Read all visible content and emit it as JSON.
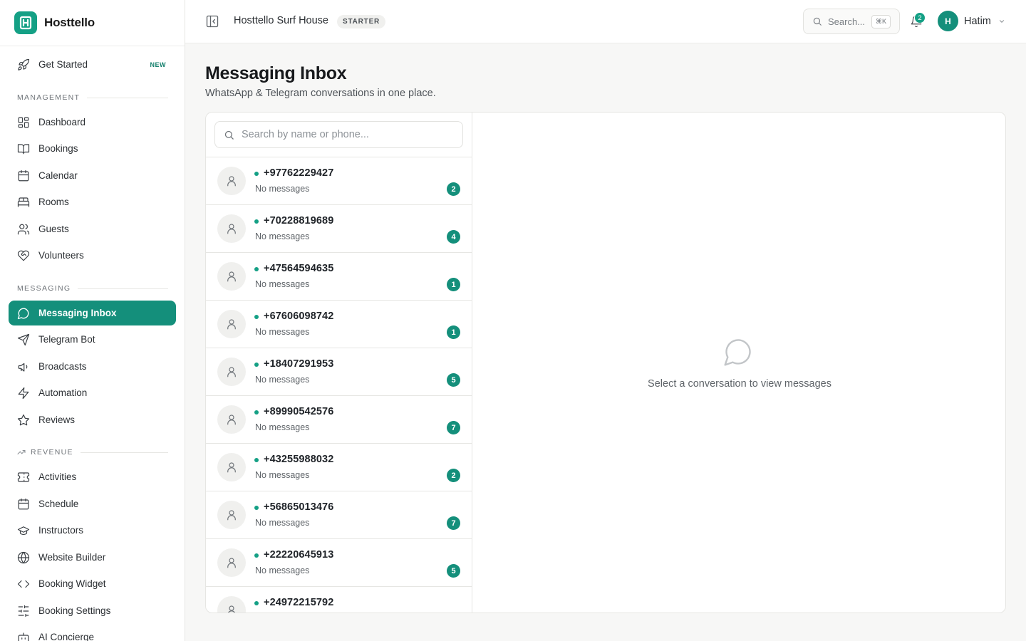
{
  "brand": {
    "name": "Hosttello"
  },
  "sidebar": {
    "get_started": {
      "label": "Get Started",
      "badge": "NEW",
      "icon": "rocket-icon"
    },
    "sections": {
      "management": "MANAGEMENT",
      "messaging": "MESSAGING",
      "revenue": "REVENUE"
    },
    "management_items": [
      {
        "label": "Dashboard",
        "icon": "dashboard-icon"
      },
      {
        "label": "Bookings",
        "icon": "book-icon"
      },
      {
        "label": "Calendar",
        "icon": "calendar-icon"
      },
      {
        "label": "Rooms",
        "icon": "bed-icon"
      },
      {
        "label": "Guests",
        "icon": "users-icon"
      },
      {
        "label": "Volunteers",
        "icon": "heart-handshake-icon"
      }
    ],
    "messaging_items": [
      {
        "label": "Messaging Inbox",
        "icon": "chat-bubble-icon",
        "active": true
      },
      {
        "label": "Telegram Bot",
        "icon": "send-icon"
      },
      {
        "label": "Broadcasts",
        "icon": "megaphone-icon"
      },
      {
        "label": "Automation",
        "icon": "zap-icon"
      },
      {
        "label": "Reviews",
        "icon": "star-icon"
      }
    ],
    "revenue_items": [
      {
        "label": "Activities",
        "icon": "ticket-icon"
      },
      {
        "label": "Schedule",
        "icon": "calendar-icon"
      },
      {
        "label": "Instructors",
        "icon": "graduation-cap-icon"
      },
      {
        "label": "Website Builder",
        "icon": "globe-icon"
      },
      {
        "label": "Booking Widget",
        "icon": "code-icon"
      },
      {
        "label": "Booking Settings",
        "icon": "sliders-icon"
      },
      {
        "label": "AI Concierge",
        "icon": "bot-icon"
      }
    ]
  },
  "header": {
    "org_name": "Hosttello Surf House",
    "plan": "STARTER",
    "search_placeholder": "Search...",
    "search_shortcut": "⌘K",
    "notifications_count": "2",
    "user": {
      "initial": "H",
      "name": "Hatim"
    }
  },
  "main": {
    "title": "Messaging Inbox",
    "subtitle": "WhatsApp & Telegram conversations in one place.",
    "search_placeholder": "Search by name or phone...",
    "empty_text": "Select a conversation to view messages",
    "conversations": [
      {
        "phone": "+97762229427",
        "preview": "No messages",
        "unread": "2"
      },
      {
        "phone": "+70228819689",
        "preview": "No messages",
        "unread": "4"
      },
      {
        "phone": "+47564594635",
        "preview": "No messages",
        "unread": "1"
      },
      {
        "phone": "+67606098742",
        "preview": "No messages",
        "unread": "1"
      },
      {
        "phone": "+18407291953",
        "preview": "No messages",
        "unread": "5"
      },
      {
        "phone": "+89990542576",
        "preview": "No messages",
        "unread": "7"
      },
      {
        "phone": "+43255988032",
        "preview": "No messages",
        "unread": "2"
      },
      {
        "phone": "+56865013476",
        "preview": "No messages",
        "unread": "7"
      },
      {
        "phone": "+22220645913",
        "preview": "No messages",
        "unread": "5"
      },
      {
        "phone": "+24972215792",
        "preview": "",
        "unread": ""
      }
    ]
  },
  "colors": {
    "accent": "#148f7b",
    "brand": "#14a085"
  }
}
